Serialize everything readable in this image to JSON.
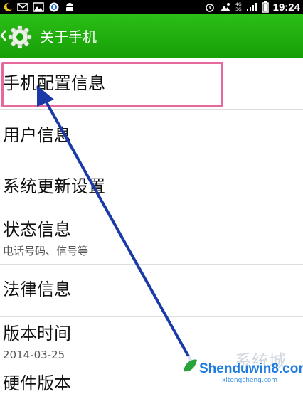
{
  "status_bar": {
    "time": "19:24",
    "network_top": "4G",
    "network_bottom": "3G",
    "icons": [
      "moon-icon",
      "mail-icon",
      "image-icon",
      "music-icon",
      "android-icon",
      "alarm-icon",
      "weather-icon",
      "signal-icon",
      "battery-icon"
    ]
  },
  "title_bar": {
    "title": "关于手机",
    "background": "#1fb00d"
  },
  "items": [
    {
      "title": "手机配置信息"
    },
    {
      "title": "用户信息"
    },
    {
      "title": "系统更新设置"
    },
    {
      "title": "状态信息",
      "subtitle": "电话号码、信号等"
    },
    {
      "title": "法律信息"
    },
    {
      "title": "版本时间",
      "subtitle": "2014-03-25"
    },
    {
      "title": "硬件版本"
    }
  ],
  "annotation": {
    "highlight_color": "#e7689c",
    "arrow_color": "#1a3aa8"
  },
  "watermark": {
    "brand": "Shenduwin8.com",
    "brand_cn": "系统城",
    "url": "xitongcheng.com"
  }
}
